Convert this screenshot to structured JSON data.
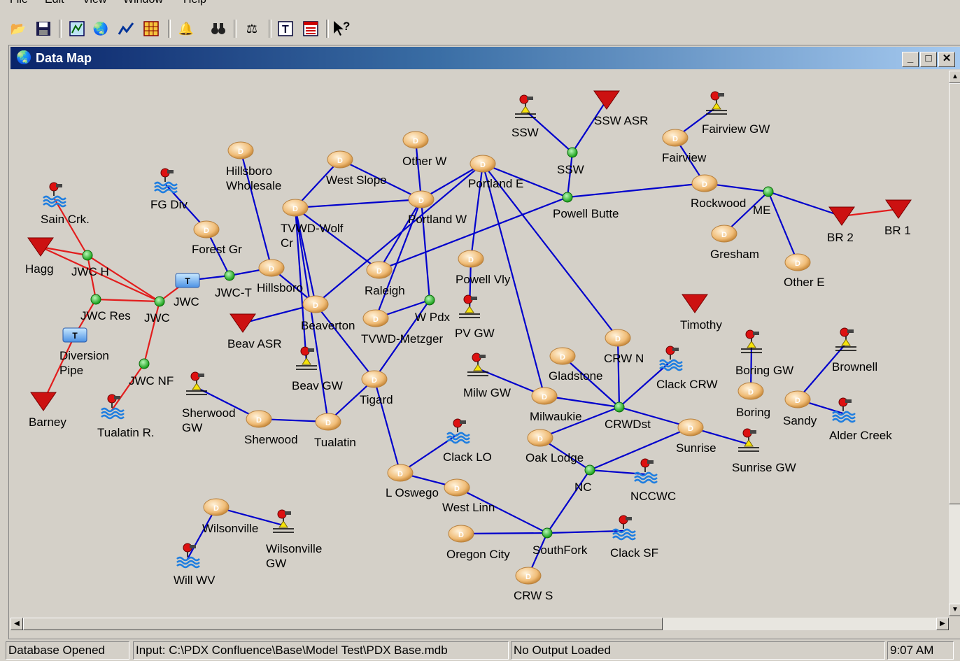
{
  "menu": [
    "File",
    "Edit",
    "View",
    "Window",
    "Help"
  ],
  "window": {
    "title": "Data Map"
  },
  "status": {
    "database": "Database Opened",
    "input": "Input: C:\\PDX Confluence\\Base\\Model Test\\PDX Base.mdb",
    "output": "No Output Loaded",
    "time": "9:07 AM"
  },
  "colors": {
    "blue_link": "#0000cc",
    "red_link": "#e21d1d",
    "junction": "#27c327",
    "demand": "#f2c484",
    "reservoir": "#cc1111"
  },
  "map": {
    "nodes": [
      {
        "id": "ssw_src",
        "type": "source",
        "label": "SSW"
      },
      {
        "id": "ssw_asr",
        "type": "reservoir",
        "label": "SSW ASR"
      },
      {
        "id": "ssw_j",
        "type": "junction",
        "label": "SSW"
      },
      {
        "id": "fairview_gw",
        "type": "source",
        "label": "Fairview GW"
      },
      {
        "id": "fairview",
        "type": "demand",
        "label": "Fairview"
      },
      {
        "id": "other_w",
        "type": "demand",
        "label": "Other W"
      },
      {
        "id": "hillsboro_wh",
        "type": "demand",
        "label": "Hillsboro\nWholesale"
      },
      {
        "id": "west_slope",
        "type": "demand",
        "label": "West Slope"
      },
      {
        "id": "portland_e",
        "type": "demand",
        "label": "Portland E"
      },
      {
        "id": "portland_w",
        "type": "demand",
        "label": "Portland W"
      },
      {
        "id": "powell_butte",
        "type": "junction",
        "label": "Powell Butte"
      },
      {
        "id": "rockwood",
        "type": "demand",
        "label": "Rockwood"
      },
      {
        "id": "me",
        "type": "junction",
        "label": "ME"
      },
      {
        "id": "br2",
        "type": "reservoir",
        "label": "BR 2"
      },
      {
        "id": "br1",
        "type": "reservoir",
        "label": "BR 1"
      },
      {
        "id": "gresham",
        "type": "demand",
        "label": "Gresham"
      },
      {
        "id": "other_e",
        "type": "demand",
        "label": "Other E"
      },
      {
        "id": "fg_div",
        "type": "source",
        "label": "FG Div"
      },
      {
        "id": "sain_crk",
        "type": "source",
        "label": "Sain Crk."
      },
      {
        "id": "hagg",
        "type": "reservoir",
        "label": "Hagg"
      },
      {
        "id": "jwc_h",
        "type": "junction",
        "label": "JWC H"
      },
      {
        "id": "forest_gr",
        "type": "demand",
        "label": "Forest Gr"
      },
      {
        "id": "tvwd_wolf",
        "type": "demand",
        "label": "TVWD-Wolf\nCr"
      },
      {
        "id": "jwct",
        "type": "junction",
        "label": "JWC-T"
      },
      {
        "id": "jwc_tank",
        "type": "tank",
        "label": "JWC"
      },
      {
        "id": "hillsboro",
        "type": "demand",
        "label": "Hillsboro"
      },
      {
        "id": "jwc_res",
        "type": "junction",
        "label": "JWC Res"
      },
      {
        "id": "jwc",
        "type": "junction",
        "label": "JWC"
      },
      {
        "id": "diversion",
        "type": "tank",
        "label": "Diversion\nPipe"
      },
      {
        "id": "raleigh",
        "type": "demand",
        "label": "Raleigh"
      },
      {
        "id": "powell_vly",
        "type": "demand",
        "label": "Powell Vly"
      },
      {
        "id": "pv_gw",
        "type": "source",
        "label": "PV GW"
      },
      {
        "id": "beaverton",
        "type": "demand",
        "label": "Beaverton"
      },
      {
        "id": "w_pdx",
        "type": "junction",
        "label": "W Pdx"
      },
      {
        "id": "tvwd_metz",
        "type": "demand",
        "label": "TVWD-Metzger"
      },
      {
        "id": "beav_asr",
        "type": "reservoir",
        "label": "Beav ASR"
      },
      {
        "id": "timothy",
        "type": "reservoir",
        "label": "Timothy"
      },
      {
        "id": "barney",
        "type": "reservoir",
        "label": "Barney"
      },
      {
        "id": "jwc_nf",
        "type": "junction",
        "label": "JWC NF"
      },
      {
        "id": "crw_n",
        "type": "demand",
        "label": "CRW N"
      },
      {
        "id": "beav_gw",
        "type": "source",
        "label": "Beav GW"
      },
      {
        "id": "boring_gw",
        "type": "source",
        "label": "Boring GW"
      },
      {
        "id": "brownell",
        "type": "source",
        "label": "Brownell"
      },
      {
        "id": "milw_gw",
        "type": "source",
        "label": "Milw GW"
      },
      {
        "id": "gladstone",
        "type": "demand",
        "label": "Gladstone"
      },
      {
        "id": "clack_crw",
        "type": "source",
        "label": "Clack CRW"
      },
      {
        "id": "tigard",
        "type": "demand",
        "label": "Tigard"
      },
      {
        "id": "boring",
        "type": "demand",
        "label": "Boring"
      },
      {
        "id": "sherwood_gw",
        "type": "source",
        "label": "Sherwood\nGW"
      },
      {
        "id": "milwaukie",
        "type": "demand",
        "label": "Milwaukie"
      },
      {
        "id": "crwdst",
        "type": "junction",
        "label": "CRWDst"
      },
      {
        "id": "sandy",
        "type": "demand",
        "label": "Sandy"
      },
      {
        "id": "alder_creek",
        "type": "source",
        "label": "Alder Creek"
      },
      {
        "id": "tualatin_r",
        "type": "source",
        "label": "Tualatin R."
      },
      {
        "id": "sherwood",
        "type": "demand",
        "label": "Sherwood"
      },
      {
        "id": "tualatin",
        "type": "demand",
        "label": "Tualatin"
      },
      {
        "id": "sunrise",
        "type": "demand",
        "label": "Sunrise"
      },
      {
        "id": "sunrise_gw",
        "type": "source",
        "label": "Sunrise GW"
      },
      {
        "id": "clack_lo",
        "type": "source",
        "label": "Clack LO"
      },
      {
        "id": "oak_lodge",
        "type": "demand",
        "label": "Oak Lodge"
      },
      {
        "id": "nc",
        "type": "junction",
        "label": "NC"
      },
      {
        "id": "nccwc",
        "type": "source",
        "label": "NCCWC"
      },
      {
        "id": "l_oswego",
        "type": "demand",
        "label": "L Oswego"
      },
      {
        "id": "west_linn",
        "type": "demand",
        "label": "West Linn"
      },
      {
        "id": "wilsonville",
        "type": "demand",
        "label": "Wilsonville"
      },
      {
        "id": "wilsonville_gw",
        "type": "source",
        "label": "Wilsonville\nGW"
      },
      {
        "id": "oregon_city",
        "type": "demand",
        "label": "Oregon City"
      },
      {
        "id": "southfork",
        "type": "junction",
        "label": "SouthFork"
      },
      {
        "id": "clack_sf",
        "type": "source",
        "label": "Clack SF"
      },
      {
        "id": "will_wv",
        "type": "source",
        "label": "Will WV"
      },
      {
        "id": "crw_s",
        "type": "demand",
        "label": "CRW S"
      }
    ],
    "links": [
      [
        "ssw_src",
        "ssw_j",
        "blue"
      ],
      [
        "ssw_asr",
        "ssw_j",
        "blue"
      ],
      [
        "ssw_j",
        "powell_butte",
        "blue"
      ],
      [
        "fairview_gw",
        "fairview",
        "blue"
      ],
      [
        "fairview",
        "rockwood",
        "blue"
      ],
      [
        "powell_butte",
        "rockwood",
        "blue"
      ],
      [
        "rockwood",
        "me",
        "blue"
      ],
      [
        "me",
        "br2",
        "blue"
      ],
      [
        "br2",
        "br1",
        "red"
      ],
      [
        "me",
        "gresham",
        "blue"
      ],
      [
        "me",
        "other_e",
        "blue"
      ],
      [
        "portland_e",
        "powell_butte",
        "blue"
      ],
      [
        "portland_w",
        "portland_e",
        "blue"
      ],
      [
        "other_w",
        "portland_w",
        "blue"
      ],
      [
        "west_slope",
        "portland_w",
        "blue"
      ],
      [
        "west_slope",
        "tvwd_wolf",
        "blue"
      ],
      [
        "tvwd_wolf",
        "portland_w",
        "blue"
      ],
      [
        "powell_butte",
        "raleigh",
        "blue"
      ],
      [
        "portland_w",
        "raleigh",
        "blue"
      ],
      [
        "portland_w",
        "w_pdx",
        "blue"
      ],
      [
        "portland_w",
        "tvwd_metz",
        "blue"
      ],
      [
        "portland_e",
        "beaverton",
        "blue"
      ],
      [
        "portland_e",
        "powell_vly",
        "blue"
      ],
      [
        "portland_e",
        "milwaukie",
        "blue"
      ],
      [
        "portland_e",
        "crw_n",
        "blue"
      ],
      [
        "powell_vly",
        "pv_gw",
        "blue"
      ],
      [
        "crw_n",
        "crwdst",
        "blue"
      ],
      [
        "hillsboro_wh",
        "hillsboro",
        "blue"
      ],
      [
        "fg_div",
        "forest_gr",
        "blue"
      ],
      [
        "forest_gr",
        "jwct",
        "blue"
      ],
      [
        "jwc_tank",
        "jwct",
        "blue"
      ],
      [
        "jwct",
        "hillsboro",
        "blue"
      ],
      [
        "hillsboro",
        "beaverton",
        "blue"
      ],
      [
        "tvwd_wolf",
        "raleigh",
        "blue"
      ],
      [
        "tvwd_wolf",
        "beaverton",
        "blue"
      ],
      [
        "tvwd_wolf",
        "beav_gw",
        "blue"
      ],
      [
        "beaverton",
        "beav_asr",
        "blue"
      ],
      [
        "beaverton",
        "tigard",
        "blue"
      ],
      [
        "tvwd_wolf",
        "tualatin",
        "blue"
      ],
      [
        "tvwd_metz",
        "w_pdx",
        "blue"
      ],
      [
        "w_pdx",
        "tigard",
        "blue"
      ],
      [
        "tigard",
        "tualatin",
        "blue"
      ],
      [
        "tigard",
        "l_oswego",
        "blue"
      ],
      [
        "l_oswego",
        "clack_lo",
        "blue"
      ],
      [
        "l_oswego",
        "west_linn",
        "blue"
      ],
      [
        "west_linn",
        "southfork",
        "blue"
      ],
      [
        "oregon_city",
        "southfork",
        "blue"
      ],
      [
        "southfork",
        "clack_sf",
        "blue"
      ],
      [
        "southfork",
        "crw_s",
        "blue"
      ],
      [
        "southfork",
        "nc",
        "blue"
      ],
      [
        "nc",
        "oak_lodge",
        "blue"
      ],
      [
        "nc",
        "nccwc",
        "blue"
      ],
      [
        "nc",
        "sunrise",
        "blue"
      ],
      [
        "oak_lodge",
        "crwdst",
        "blue"
      ],
      [
        "milw_gw",
        "milwaukie",
        "blue"
      ],
      [
        "milwaukie",
        "crwdst",
        "blue"
      ],
      [
        "gladstone",
        "crwdst",
        "blue"
      ],
      [
        "clack_crw",
        "crwdst",
        "blue"
      ],
      [
        "crwdst",
        "sunrise",
        "blue"
      ],
      [
        "sunrise",
        "sunrise_gw",
        "blue"
      ],
      [
        "boring_gw",
        "boring",
        "blue"
      ],
      [
        "brownell",
        "sandy",
        "blue"
      ],
      [
        "sandy",
        "alder_creek",
        "blue"
      ],
      [
        "sherwood_gw",
        "sherwood",
        "blue"
      ],
      [
        "sherwood",
        "tualatin",
        "blue"
      ],
      [
        "wilsonville",
        "wilsonville_gw",
        "blue"
      ],
      [
        "wilsonville",
        "will_wv",
        "blue"
      ],
      [
        "sain_crk",
        "jwc_h",
        "red"
      ],
      [
        "hagg",
        "jwc_h",
        "red"
      ],
      [
        "hagg",
        "jwc",
        "red"
      ],
      [
        "jwc_h",
        "jwc_res",
        "red"
      ],
      [
        "jwc_h",
        "jwc",
        "red"
      ],
      [
        "jwc_res",
        "jwc",
        "red"
      ],
      [
        "jwc_res",
        "diversion",
        "red"
      ],
      [
        "jwc",
        "jwc_tank",
        "red"
      ],
      [
        "jwc",
        "jwc_nf",
        "red"
      ],
      [
        "jwc_nf",
        "tualatin_r",
        "red"
      ],
      [
        "diversion",
        "barney",
        "red"
      ]
    ]
  }
}
